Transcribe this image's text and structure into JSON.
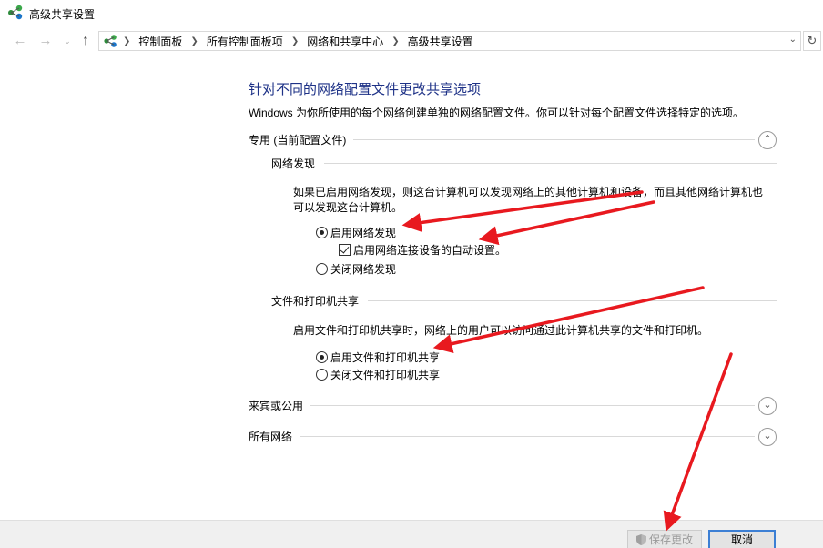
{
  "window": {
    "title": "高级共享设置"
  },
  "nav": {
    "back_icon": "arrow-left-icon",
    "forward_icon": "arrow-right-icon",
    "recent_icon": "chevron-down-icon",
    "up_icon": "arrow-up-icon",
    "breadcrumbs": [
      "控制面板",
      "所有控制面板项",
      "网络和共享中心",
      "高级共享设置"
    ],
    "refresh_icon": "refresh-icon"
  },
  "main": {
    "heading": "针对不同的网络配置文件更改共享选项",
    "description": "Windows 为你所使用的每个网络创建单独的网络配置文件。你可以针对每个配置文件选择特定的选项。",
    "profiles": [
      {
        "label": "专用 (当前配置文件)",
        "expanded": true
      },
      {
        "label": "来宾或公用",
        "expanded": false
      },
      {
        "label": "所有网络",
        "expanded": false
      }
    ],
    "network_discovery": {
      "heading": "网络发现",
      "text_line1": "如果已启用网络发现，则这台计算机可以发现网络上的其他计算机和设备，而且其他网络计算机也",
      "text_line2": "可以发现这台计算机。",
      "enable_label": "启用网络发现",
      "enable_selected": true,
      "auto_setup_label": "启用网络连接设备的自动设置。",
      "auto_setup_checked": true,
      "disable_label": "关闭网络发现",
      "disable_selected": false
    },
    "file_printer_sharing": {
      "heading": "文件和打印机共享",
      "text": "启用文件和打印机共享时，网络上的用户可以访问通过此计算机共享的文件和打印机。",
      "enable_label": "启用文件和打印机共享",
      "enable_selected": true,
      "disable_label": "关闭文件和打印机共享",
      "disable_selected": false
    }
  },
  "footer": {
    "save_label": "保存更改",
    "save_enabled": false,
    "cancel_label": "取消"
  },
  "colors": {
    "heading": "#1e3287",
    "annotation_arrow": "#e8191f",
    "focus_border": "#3c7fd4"
  }
}
